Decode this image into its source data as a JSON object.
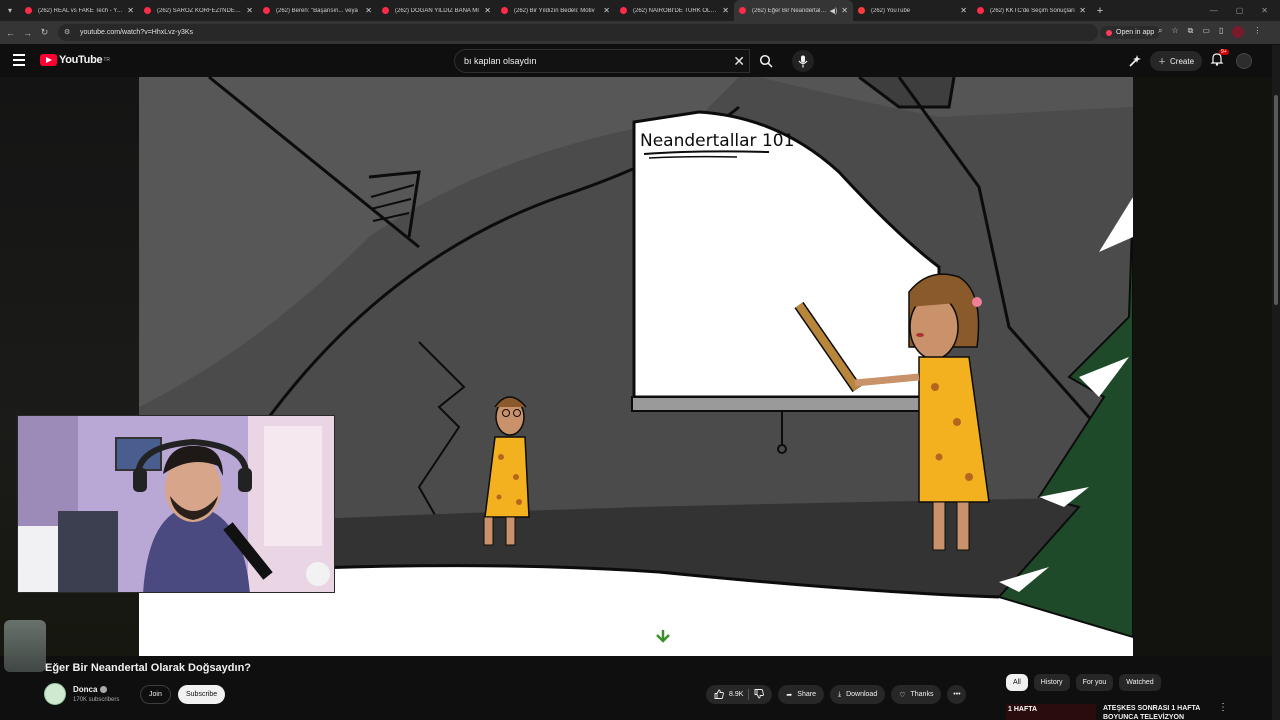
{
  "browser": {
    "tabs": [
      {
        "label": "(262) REAL vs FAKE Tech - YouT",
        "active": false
      },
      {
        "label": "(262) SAROZ KÖRFEZİ'NDE KIL",
        "active": false
      },
      {
        "label": "(262) Beren: \"Başarısın... veya",
        "active": false
      },
      {
        "label": "(262) DOĞAN YILDIZ BANA Mİ",
        "active": false
      },
      {
        "label": "(262) Bir Yıldızın Bedeli: Motiv",
        "active": false
      },
      {
        "label": "(262) NAIROBİ'DE TÜRK OLMA",
        "active": false
      },
      {
        "label": "(262) Eğer Bir Neandertal O",
        "active": true
      },
      {
        "label": "(262) YouTube",
        "active": false
      },
      {
        "label": "(262) KKTC'de Seçim Sonuçları",
        "active": false
      }
    ],
    "url": "youtube.com/watch?v=HhxLvz-y3Ks",
    "open_in_app": "Open in app"
  },
  "youtube": {
    "logo": "YouTube",
    "country": "TR",
    "search_query": "bı kaplan olsaydın",
    "create_label": "Create",
    "notification_count": "9+"
  },
  "video": {
    "board_title": "Neandertallar 101",
    "title": "Eğer Bir Neandertal Olarak Doğsaydın?",
    "channel": "Donca",
    "subscribers": "170K subscribers",
    "join_label": "Join",
    "subscribe_label": "Subscribe",
    "likes": "8.9K",
    "share_label": "Share",
    "download_label": "Download",
    "thanks_label": "Thanks"
  },
  "sidebar": {
    "chips": [
      "All",
      "History",
      "For you",
      "Watched"
    ],
    "recommendation": {
      "thumb_text": "1 HAFTA",
      "title": "ATEŞKES SONRASI 1 HAFTA BOYUNCA TELEVİZYON"
    }
  },
  "colors": {
    "youtube_red": "#ff0033",
    "background": "#0f0f0f",
    "chip_bg": "#272727"
  }
}
